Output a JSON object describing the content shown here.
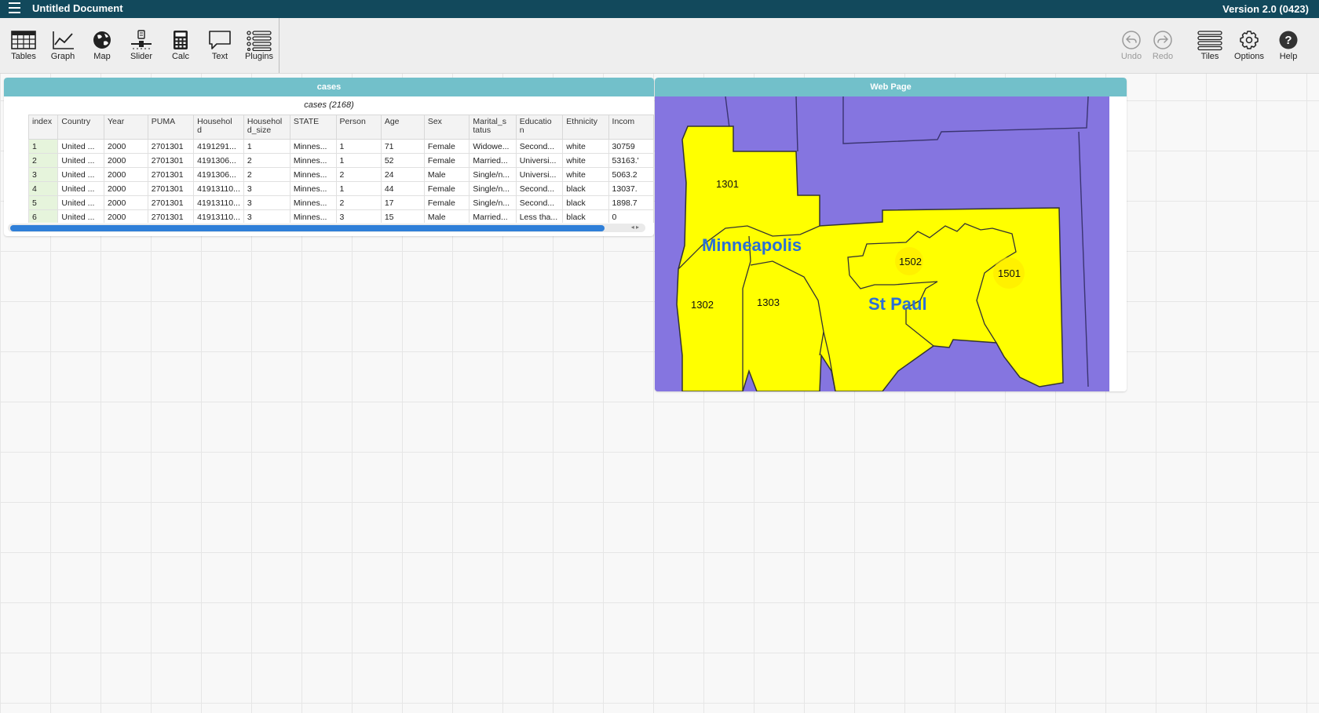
{
  "app": {
    "doc_title": "Untitled Document",
    "version": "Version 2.0 (0423)"
  },
  "toolbar": {
    "left": [
      {
        "label": "Tables",
        "icon": "table-icon"
      },
      {
        "label": "Graph",
        "icon": "graph-icon"
      },
      {
        "label": "Map",
        "icon": "globe-icon"
      },
      {
        "label": "Slider",
        "icon": "slider-icon"
      },
      {
        "label": "Calc",
        "icon": "calculator-icon"
      },
      {
        "label": "Text",
        "icon": "speech-bubble-icon"
      },
      {
        "label": "Plugins",
        "icon": "plugins-icon"
      }
    ],
    "right": [
      {
        "label": "Undo",
        "icon": "undo-icon",
        "disabled": true
      },
      {
        "label": "Redo",
        "icon": "redo-icon",
        "disabled": true
      },
      {
        "label": "Tiles",
        "icon": "tiles-icon",
        "disabled": false
      },
      {
        "label": "Options",
        "icon": "gear-icon",
        "disabled": false
      },
      {
        "label": "Help",
        "icon": "help-icon",
        "disabled": false
      }
    ]
  },
  "cases_tile": {
    "title": "cases",
    "caption": "cases (2168)",
    "columns": [
      "index",
      "Country",
      "Year",
      "PUMA",
      "Househol\nd",
      "Househol\nd_size",
      "STATE",
      "Person",
      "Age",
      "Sex",
      "Marital_s\ntatus",
      "Educatio\nn",
      "Ethnicity",
      "Incom"
    ],
    "rows": [
      [
        "1",
        "United ...",
        "2000",
        "2701301",
        "4191291...",
        "1",
        "Minnes...",
        "1",
        "71",
        "Female",
        "Widowe...",
        "Second...",
        "white",
        "30759"
      ],
      [
        "2",
        "United ...",
        "2000",
        "2701301",
        "4191306...",
        "2",
        "Minnes...",
        "1",
        "52",
        "Female",
        "Married...",
        "Universi...",
        "white",
        "53163.'"
      ],
      [
        "3",
        "United ...",
        "2000",
        "2701301",
        "4191306...",
        "2",
        "Minnes...",
        "2",
        "24",
        "Male",
        "Single/n...",
        "Universi...",
        "white",
        "5063.2"
      ],
      [
        "4",
        "United ...",
        "2000",
        "2701301",
        "41913110...",
        "3",
        "Minnes...",
        "1",
        "44",
        "Female",
        "Single/n...",
        "Second...",
        "black",
        "13037."
      ],
      [
        "5",
        "United ...",
        "2000",
        "2701301",
        "41913110...",
        "3",
        "Minnes...",
        "2",
        "17",
        "Female",
        "Single/n...",
        "Second...",
        "black",
        "1898.7"
      ],
      [
        "6",
        "United ...",
        "2000",
        "2701301",
        "41913110...",
        "3",
        "Minnes...",
        "3",
        "15",
        "Male",
        "Married...",
        "Less tha...",
        "black",
        "0"
      ]
    ]
  },
  "web_tile": {
    "title": "Web Page",
    "map_labels": {
      "minneapolis": "Minneapolis",
      "st_paul": "St Paul",
      "p1301": "1301",
      "p1302": "1302",
      "p1303": "1303",
      "p1501": "1501",
      "p1502": "1502"
    },
    "colors": {
      "water": "#8575e0",
      "district": "#ffff00",
      "city_label": "#2a6fd6"
    }
  }
}
